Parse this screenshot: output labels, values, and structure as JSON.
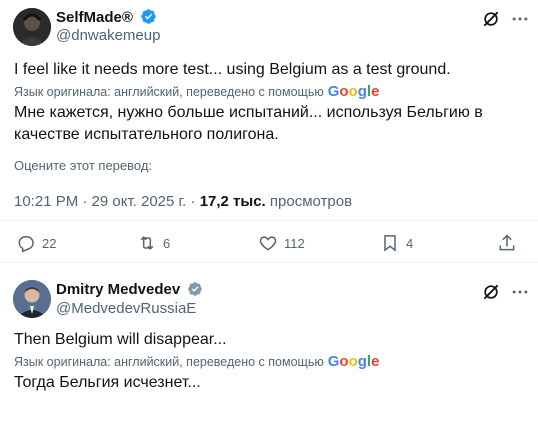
{
  "tweet1": {
    "display_name": "SelfMade®",
    "handle": "@dnwakemeup",
    "original_text": "I feel like it needs more test... using Belgium as a test ground.",
    "translated_note": "Язык оригинала: английский, переведено с помощью",
    "translated_text": "Мне кажется, нужно больше испытаний... используя Бельгию в качестве испытательного полигона.",
    "rate_prompt": "Оцените этот перевод:",
    "timestamp": "10:21 PM · 29 окт. 2025 г. · ",
    "views_count": "17,2 тыс.",
    "views_label": " просмотров",
    "replies": "22",
    "reposts": "6",
    "likes": "112",
    "bookmarks": "4"
  },
  "tweet2": {
    "display_name": "Dmitry Medvedev",
    "handle": "@MedvedevRussiaE",
    "original_text": "Then Belgium will disappear...",
    "translated_note": "Язык оригинала: английский, переведено с помощью",
    "translated_text": "Тогда Бельгия исчезнет..."
  },
  "google_logo": "Google",
  "colors": {
    "text": "#0f1419",
    "secondary": "#536471",
    "verified": "#1d9bf0",
    "divider": "#eff3f4"
  }
}
